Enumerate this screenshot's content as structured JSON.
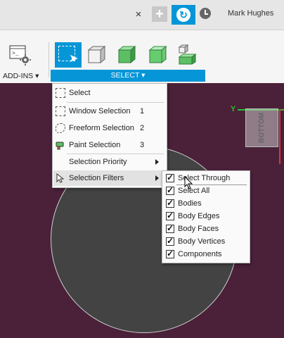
{
  "header": {
    "tab_close": "×",
    "new_tab": "+",
    "user_name": "Mark Hughes"
  },
  "toolbar": {
    "addins_label": "ADD-INS ▾",
    "select_label": "SELECT ▾",
    "tools": [
      "select-tool",
      "box-tool",
      "solid-tool",
      "face-tool",
      "component-tool"
    ]
  },
  "viewport": {
    "view_cube_face": "BOTTOM",
    "axis_label": "Y",
    "colors": {
      "background": "#4a2139",
      "axis_y": "#2dbb2d",
      "axis_z": "#d23b3b",
      "accent": "#0696d7"
    }
  },
  "select_menu": {
    "items": [
      {
        "label": "Select",
        "shortcut": ""
      },
      {
        "label": "Window Selection",
        "shortcut": "1"
      },
      {
        "label": "Freeform Selection",
        "shortcut": "2"
      },
      {
        "label": "Paint Selection",
        "shortcut": "3"
      },
      {
        "label": "Selection Priority",
        "shortcut": ""
      },
      {
        "label": "Selection Filters",
        "shortcut": ""
      }
    ]
  },
  "filters_menu": {
    "items": [
      {
        "label": "Select Through",
        "checked": true
      },
      {
        "label": "Select All",
        "checked": true
      },
      {
        "label": "Bodies",
        "checked": true
      },
      {
        "label": "Body Edges",
        "checked": true
      },
      {
        "label": "Body Faces",
        "checked": true
      },
      {
        "label": "Body Vertices",
        "checked": true
      },
      {
        "label": "Components",
        "checked": true
      }
    ]
  }
}
